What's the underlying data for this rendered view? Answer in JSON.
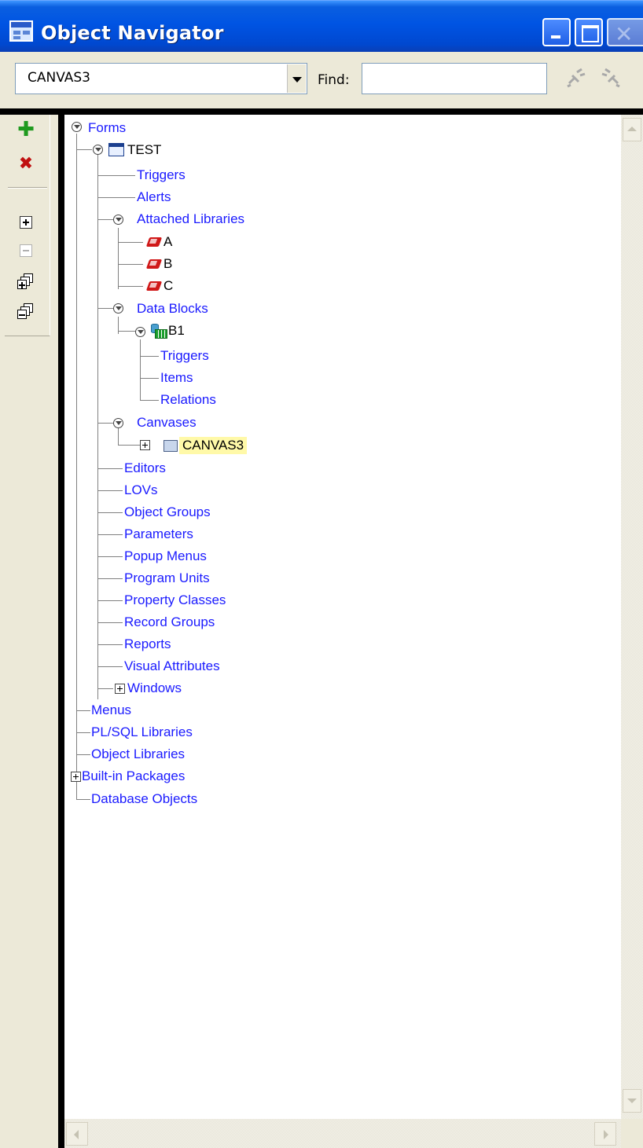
{
  "window": {
    "title": "Object Navigator",
    "close_glyph": "✕"
  },
  "toolbar": {
    "context_value": "CANVAS3",
    "find_label": "Find:",
    "find_value": "",
    "search_prev_icon": "flashlight-prev-icon",
    "search_next_icon": "flashlight-next-icon"
  },
  "side_tools": {
    "create_glyph": "✚",
    "delete_glyph": "✖"
  },
  "tree": {
    "forms": "Forms",
    "test": "TEST",
    "triggers": "Triggers",
    "alerts": "Alerts",
    "attached_libraries": "Attached Libraries",
    "lib_a": "A",
    "lib_b": "B",
    "lib_c": "C",
    "data_blocks": "Data Blocks",
    "b1": "B1",
    "b1_triggers": "Triggers",
    "b1_items": "Items",
    "b1_relations": "Relations",
    "canvases": "Canvases",
    "canvas3": "CANVAS3",
    "editors": "Editors",
    "lovs": "LOVs",
    "object_groups": "Object Groups",
    "parameters": "Parameters",
    "popup_menus": "Popup Menus",
    "program_units": "Program Units",
    "property_classes": "Property Classes",
    "record_groups": "Record Groups",
    "reports": "Reports",
    "visual_attributes": "Visual Attributes",
    "windows": "Windows",
    "menus": "Menus",
    "plsql_libraries": "PL/SQL Libraries",
    "object_libraries": "Object Libraries",
    "builtin_packages": "Built-in Packages",
    "database_objects": "Database Objects"
  },
  "colors": {
    "title_bar": "#0054e3",
    "node_text": "#1a1aff",
    "selection": "#fff9a8"
  }
}
